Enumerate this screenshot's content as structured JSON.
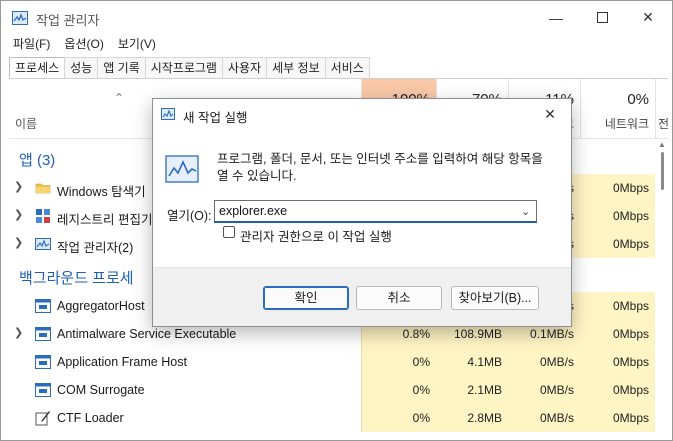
{
  "window": {
    "title": "작업 관리자"
  },
  "menu": [
    "파일(F)",
    "옵션(O)",
    "보기(V)"
  ],
  "tabs": [
    "프로세스",
    "성능",
    "앱 기록",
    "시작프로그램",
    "사용자",
    "세부 정보",
    "서비스"
  ],
  "header": {
    "name": "이름",
    "cpu_pct": "100%",
    "mem_pct": "70%",
    "disk_pct": "11%",
    "disk_label": "크",
    "net_pct": "0%",
    "net_label": "네트워크",
    "power_label": "전"
  },
  "groups": {
    "apps": "앱 (3)",
    "background": "백그라운드 프로세"
  },
  "apps": [
    {
      "name": "Windows 탐색기",
      "cpu": "",
      "mem": "",
      "disk": "/s",
      "net": "0Mbps"
    },
    {
      "name": "레지스트리 편집기",
      "cpu": "",
      "mem": "",
      "disk": "/s",
      "net": "0Mbps"
    },
    {
      "name": "작업 관리자(2)",
      "cpu": "",
      "mem": "",
      "disk": "/s",
      "net": "0Mbps"
    }
  ],
  "background": [
    {
      "name": "AggregatorHost",
      "cpu": "",
      "mem": "",
      "disk": "/s",
      "net": "0Mbps"
    },
    {
      "name": "Antimalware Service Executable",
      "cpu": "0.8%",
      "mem": "108.9MB",
      "disk": "0.1MB/s",
      "net": "0Mbps"
    },
    {
      "name": "Application Frame Host",
      "cpu": "0%",
      "mem": "4.1MB",
      "disk": "0MB/s",
      "net": "0Mbps"
    },
    {
      "name": "COM Surrogate",
      "cpu": "0%",
      "mem": "2.1MB",
      "disk": "0MB/s",
      "net": "0Mbps"
    },
    {
      "name": "CTF Loader",
      "cpu": "0%",
      "mem": "2.8MB",
      "disk": "0MB/s",
      "net": "0Mbps"
    }
  ],
  "dialog": {
    "title": "새 작업 실행",
    "description": "프로그램, 폴더, 문서, 또는 인터넷 주소를 입력하여 해당 항목을 열 수 있습니다.",
    "open_label": "열기(O):",
    "open_value": "explorer.exe",
    "admin_checkbox": "관리자 권한으로 이 작업 실행",
    "ok": "확인",
    "cancel": "취소",
    "browse": "찾아보기(B)..."
  },
  "colors": {
    "accent": "#1e5fb4",
    "cpu_header": "#f8c8a8",
    "cell_highlight": "#fff4c4"
  }
}
